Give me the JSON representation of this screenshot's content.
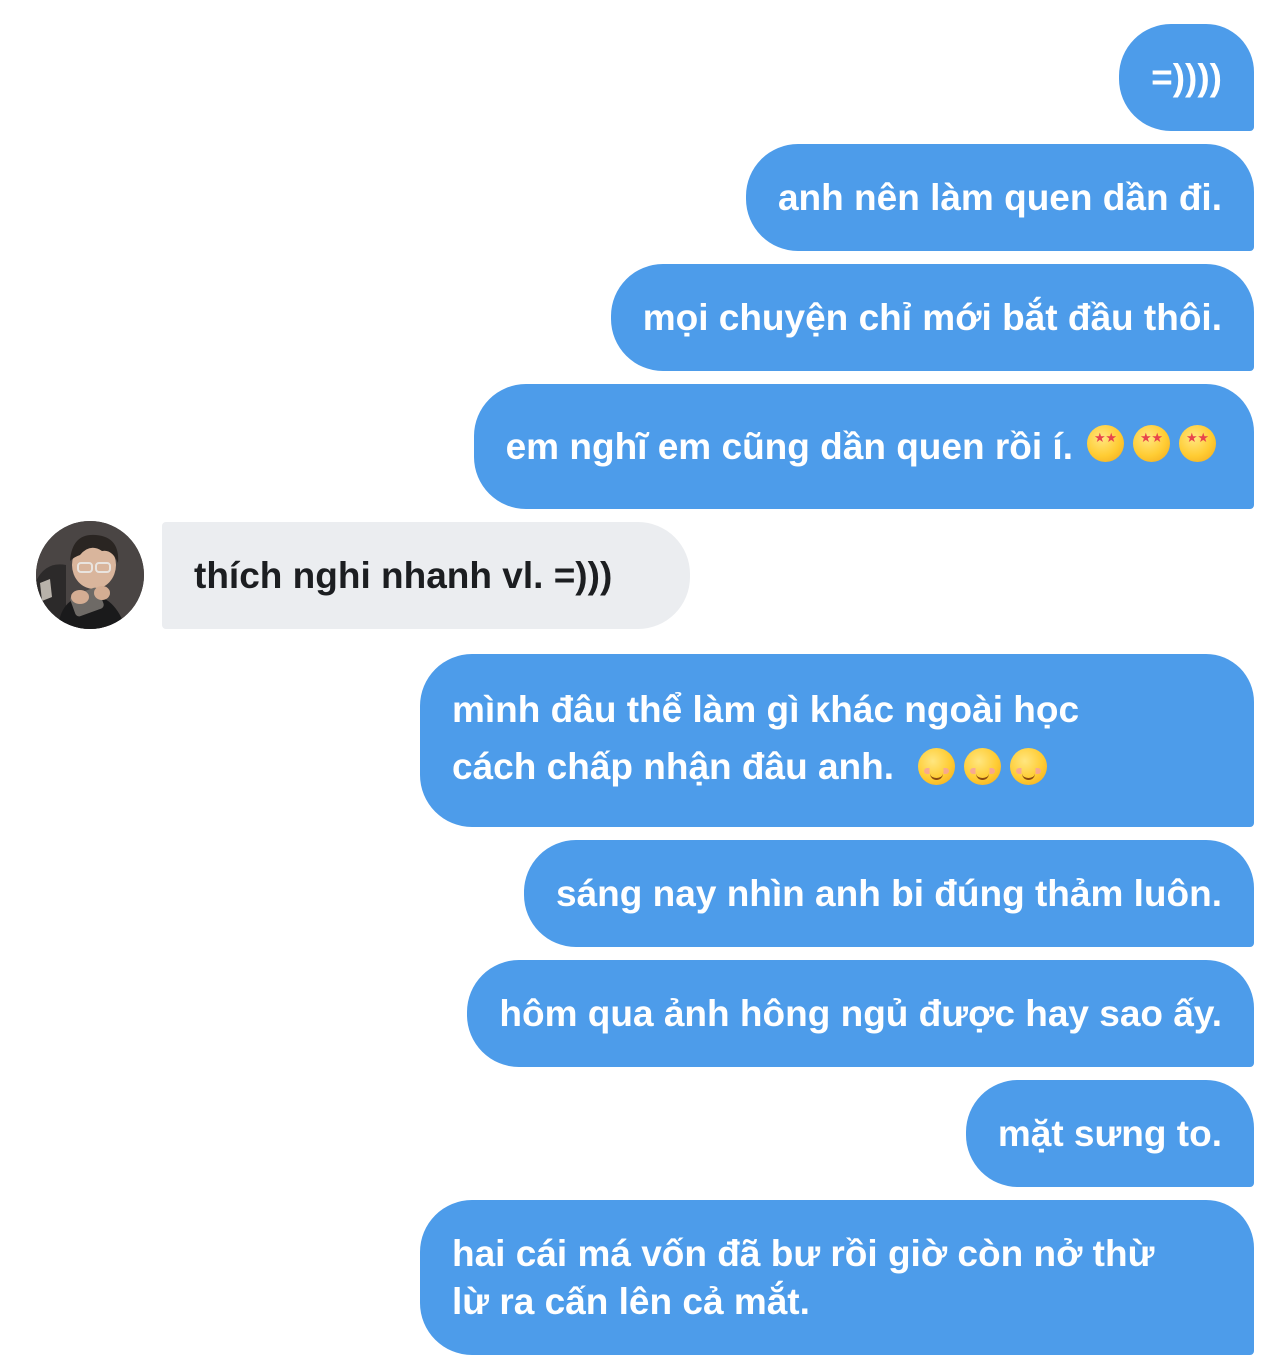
{
  "messages": [
    {
      "sender": "self",
      "lines": [
        "=))))"
      ]
    },
    {
      "sender": "self",
      "lines": [
        "anh nên làm quen dần đi."
      ]
    },
    {
      "sender": "self",
      "lines": [
        "mọi chuyện chỉ mới bắt đầu thôi."
      ]
    },
    {
      "sender": "self",
      "lines": [
        "em nghĩ em cũng dần quen rồi í."
      ],
      "emoji": [
        "star-struck-emoji",
        "star-struck-emoji",
        "star-struck-emoji"
      ]
    },
    {
      "sender": "other",
      "lines": [
        "thích nghi nhanh vl. =)))"
      ]
    },
    {
      "sender": "self",
      "lines": [
        "mình đâu thể làm gì khác ngoài học",
        "cách chấp nhận đâu anh."
      ],
      "emoji": [
        "smiling-face-emoji",
        "smiling-face-emoji",
        "smiling-face-emoji"
      ]
    },
    {
      "sender": "self",
      "lines": [
        "sáng nay nhìn anh bi đúng thảm luôn."
      ]
    },
    {
      "sender": "self",
      "lines": [
        "hôm qua ảnh hông ngủ được hay sao ấy."
      ]
    },
    {
      "sender": "self",
      "lines": [
        "mặt sưng to."
      ]
    },
    {
      "sender": "self",
      "lines": [
        "hai cái má vốn đã bư rồi giờ còn nở thừ",
        "lừ ra cấn lên cả mắt."
      ]
    }
  ],
  "colors": {
    "outgoing_bubble": "#4d9cea",
    "incoming_bubble": "#ebedf0",
    "outgoing_text": "#ffffff",
    "incoming_text": "#1c1e21"
  },
  "avatar_icon": "user-avatar-photo"
}
